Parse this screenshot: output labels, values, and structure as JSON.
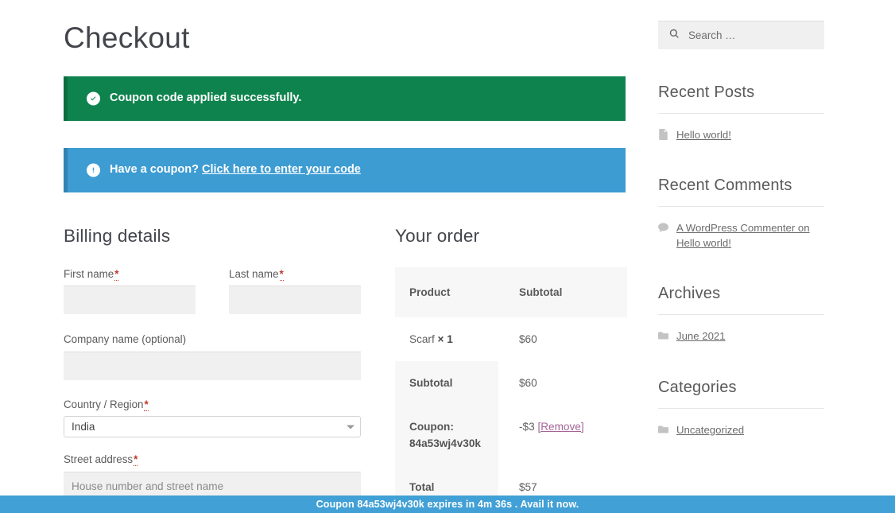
{
  "page": {
    "title": "Checkout"
  },
  "notices": {
    "success": {
      "icon": "check-circle-icon",
      "text": "Coupon code applied successfully."
    },
    "info": {
      "icon": "exclamation-circle-icon",
      "text": "Have a coupon?",
      "link_label": "Click here to enter your code"
    }
  },
  "billing": {
    "heading": "Billing details",
    "fields": [
      {
        "label": "First name",
        "required": "*",
        "value": "",
        "placeholder": ""
      },
      {
        "label": "Last name",
        "required": "*",
        "value": "",
        "placeholder": ""
      },
      {
        "label": "Company name (optional)",
        "required": "",
        "value": "",
        "placeholder": ""
      },
      {
        "label": "Country / Region",
        "required": "*",
        "value": "India",
        "placeholder": ""
      },
      {
        "label": "Street address",
        "required": "*",
        "value": "",
        "placeholder": "House number and street name"
      }
    ]
  },
  "order": {
    "heading": "Your order",
    "columns": [
      "Product",
      "Subtotal"
    ],
    "items": [
      {
        "name": "Scarf",
        "qty": "× 1",
        "subtotal": "$60"
      }
    ],
    "footer": [
      {
        "label": "Subtotal",
        "value": "$60",
        "remove_label": ""
      },
      {
        "label": "Coupon: 84a53wj4v30k",
        "value": "-$3",
        "remove_label": "[Remove]"
      },
      {
        "label": "Total",
        "value": "$57",
        "remove_label": ""
      }
    ]
  },
  "sidebar": {
    "search": {
      "placeholder": "Search …",
      "icon": "search-icon"
    },
    "widgets": [
      {
        "title": "Recent Posts",
        "items": [
          {
            "icon": "document-icon",
            "text": "Hello world!"
          }
        ]
      },
      {
        "title": "Recent Comments",
        "items": [
          {
            "icon": "comment-icon",
            "text": "A WordPress Commenter on Hello world!"
          }
        ]
      },
      {
        "title": "Archives",
        "items": [
          {
            "icon": "folder-icon",
            "text": "June 2021"
          }
        ]
      },
      {
        "title": "Categories",
        "items": [
          {
            "icon": "folder-icon",
            "text": "Uncategorized"
          }
        ]
      }
    ]
  },
  "bottom_bar": {
    "text": "Coupon 84a53wj4v30k expires in 4m 36s . Avail it now."
  },
  "colors": {
    "success": "#0f834d",
    "info": "#3d9cd2",
    "bottom_bar": "#41a0d5",
    "required": "#c0392b",
    "remove_link": "#a46497",
    "field_bg": "#f0f0f0",
    "table_head_bg": "#f7f7f7"
  }
}
